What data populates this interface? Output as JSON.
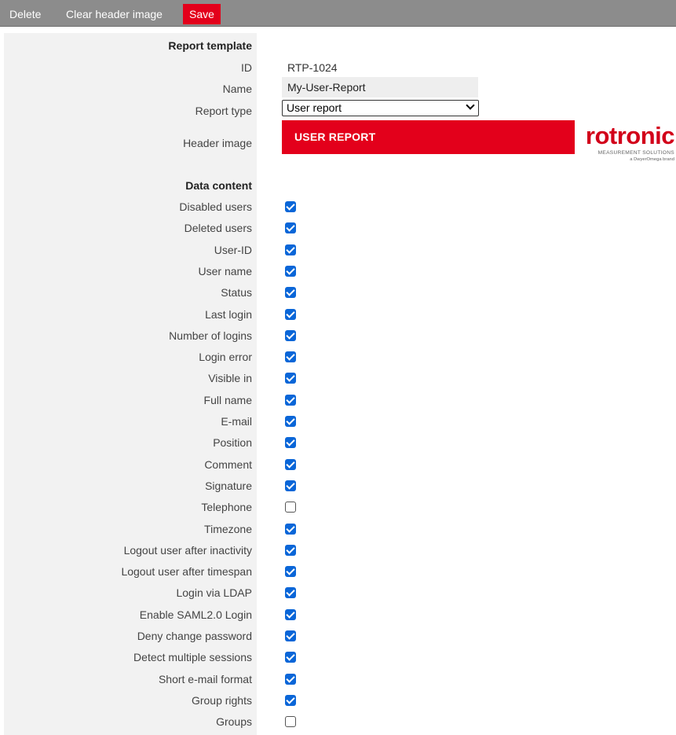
{
  "toolbar": {
    "delete_label": "Delete",
    "clear_label": "Clear header image",
    "save_label": "Save"
  },
  "section_report": {
    "title": "Report template"
  },
  "fields": {
    "id_label": "ID",
    "id_value": "RTP-1024",
    "name_label": "Name",
    "name_value": "My-User-Report",
    "type_label": "Report type",
    "type_value": "User report",
    "header_label": "Header image",
    "banner_text": "USER REPORT"
  },
  "logo": {
    "brand": "rotronic",
    "tagline": "MEASUREMENT SOLUTIONS",
    "sub": "a DwyerOmega brand"
  },
  "section_data": {
    "title": "Data content"
  },
  "items": [
    {
      "label": "Disabled users",
      "checked": true
    },
    {
      "label": "Deleted users",
      "checked": true
    },
    {
      "label": "User-ID",
      "checked": true
    },
    {
      "label": "User name",
      "checked": true
    },
    {
      "label": "Status",
      "checked": true
    },
    {
      "label": "Last login",
      "checked": true
    },
    {
      "label": "Number of logins",
      "checked": true
    },
    {
      "label": "Login error",
      "checked": true
    },
    {
      "label": "Visible in",
      "checked": true
    },
    {
      "label": "Full name",
      "checked": true
    },
    {
      "label": "E-mail",
      "checked": true
    },
    {
      "label": "Position",
      "checked": true
    },
    {
      "label": "Comment",
      "checked": true
    },
    {
      "label": "Signature",
      "checked": true
    },
    {
      "label": "Telephone",
      "checked": false
    },
    {
      "label": "Timezone",
      "checked": true
    },
    {
      "label": "Logout user after inactivity",
      "checked": true
    },
    {
      "label": "Logout user after timespan",
      "checked": true
    },
    {
      "label": "Login via LDAP",
      "checked": true
    },
    {
      "label": "Enable SAML2.0 Login",
      "checked": true
    },
    {
      "label": "Deny change password",
      "checked": true
    },
    {
      "label": "Detect multiple sessions",
      "checked": true
    },
    {
      "label": "Short e-mail format",
      "checked": true
    },
    {
      "label": "Group rights",
      "checked": true
    },
    {
      "label": "Groups",
      "checked": false
    }
  ],
  "colors": {
    "accent_red": "#e3001b",
    "checkbox_blue": "#0a66d8",
    "toolbar_gray": "#8c8c8c"
  }
}
